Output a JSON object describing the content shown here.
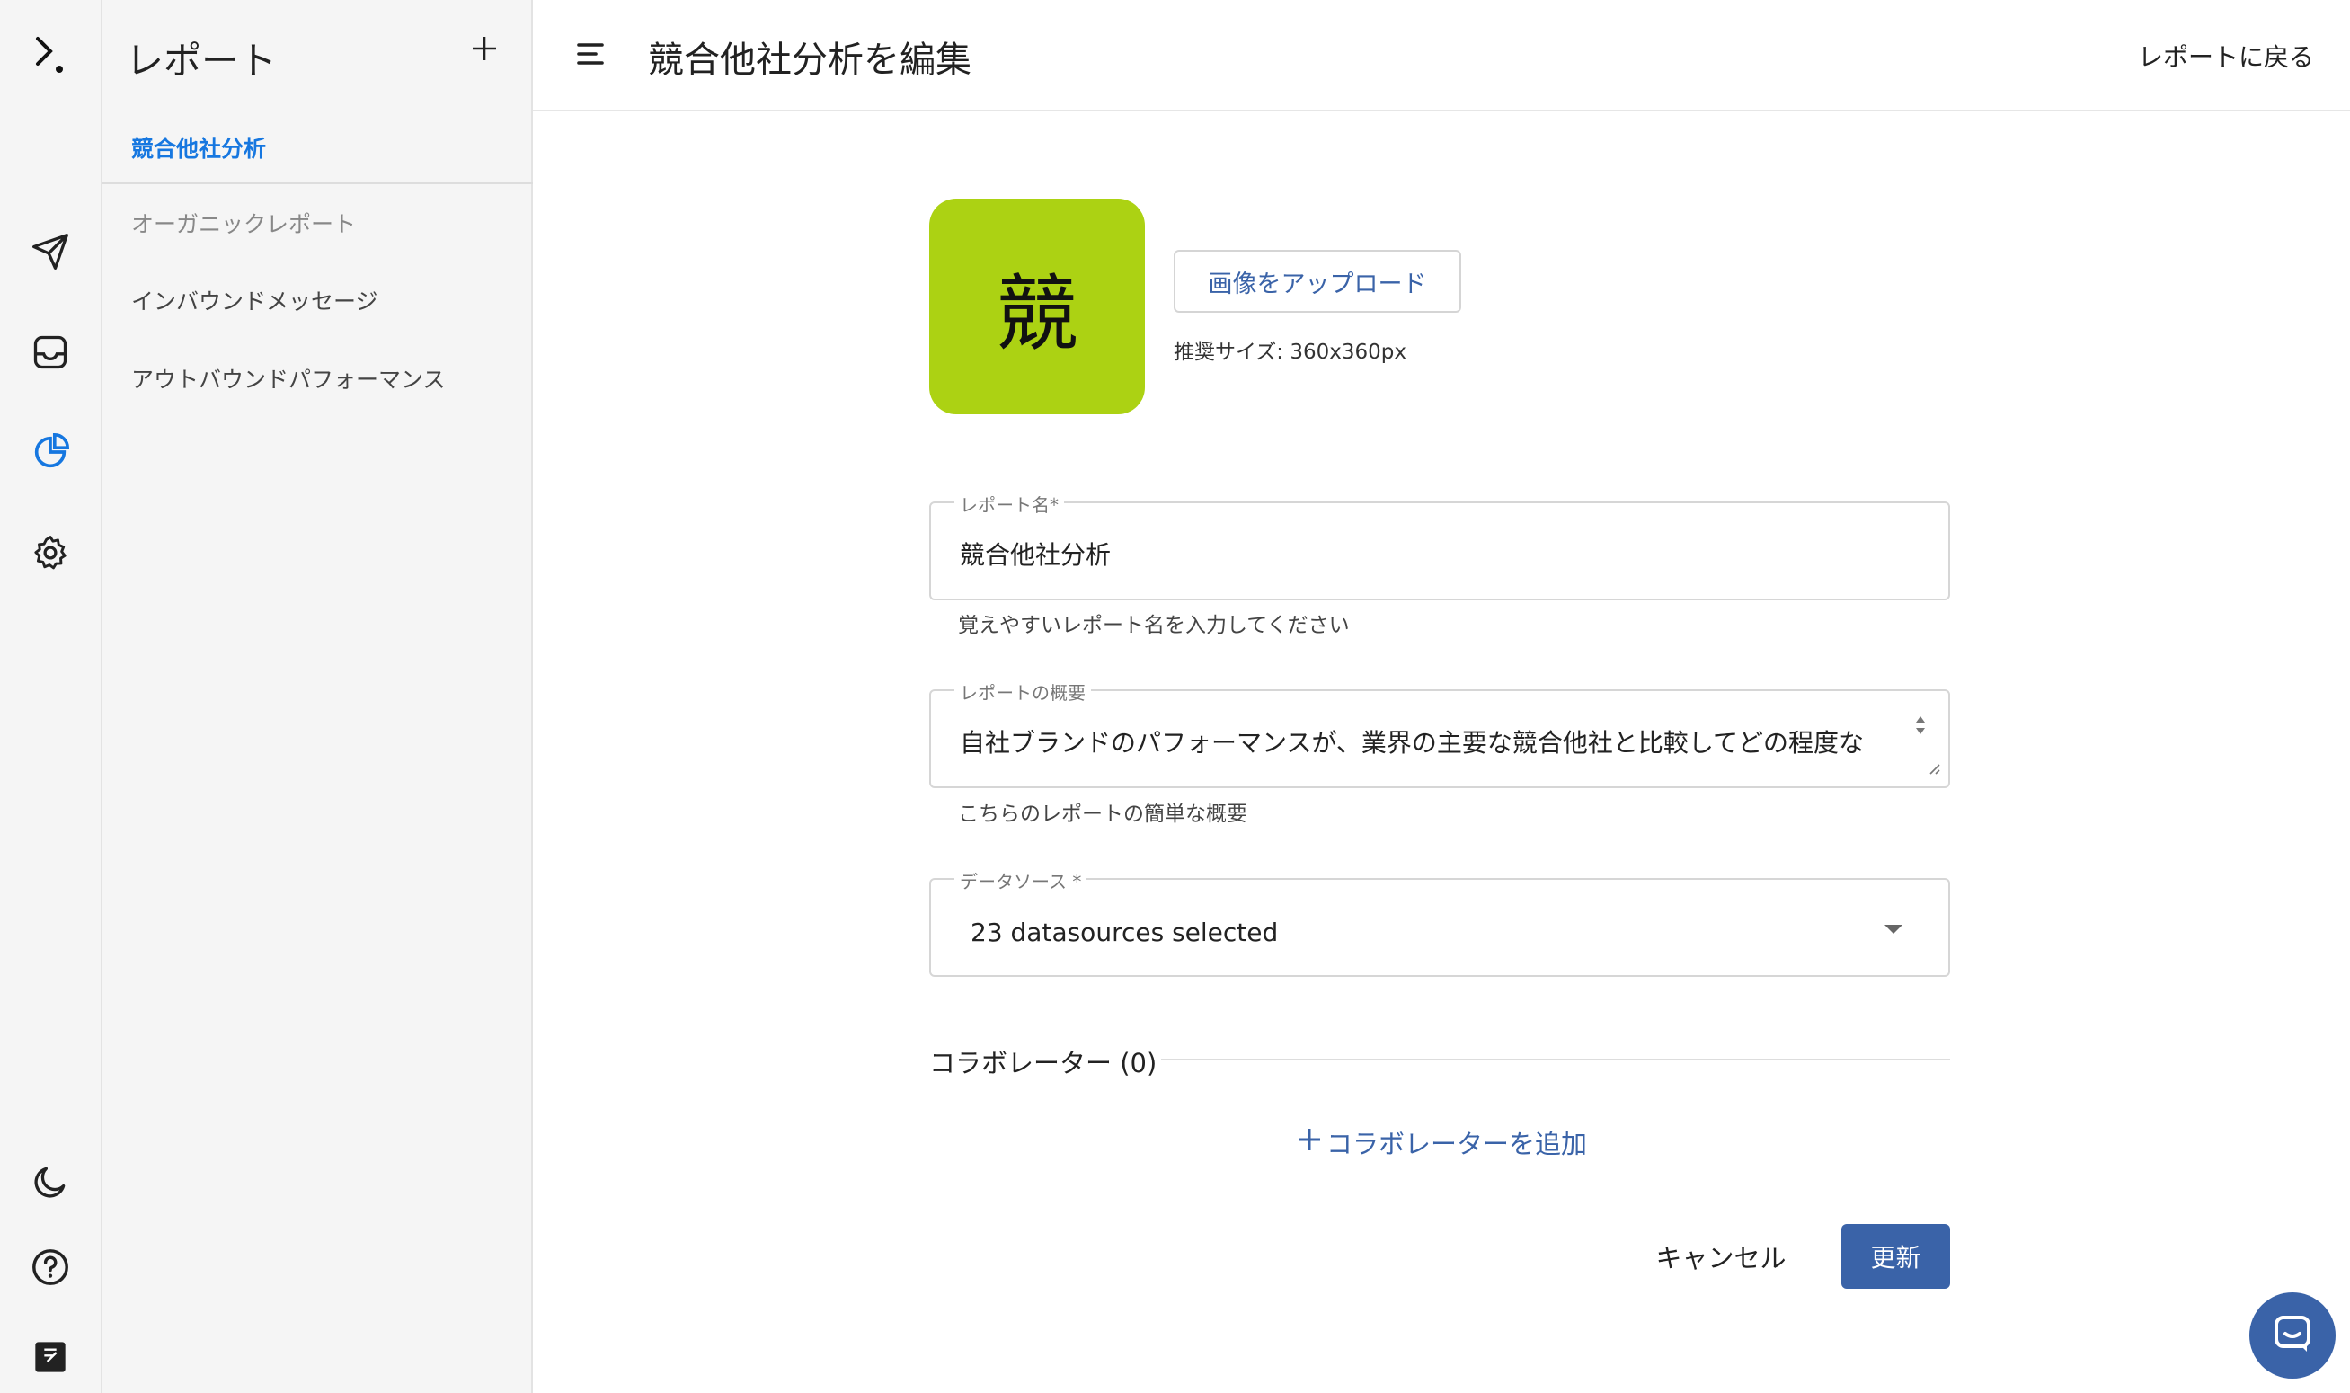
{
  "rail": {
    "icons": [
      "logo-icon",
      "send-icon",
      "inbox-icon",
      "pie-chart-icon",
      "gear-icon",
      "moon-icon",
      "help-icon",
      "notebook-icon"
    ]
  },
  "sidebar": {
    "title": "レポート",
    "items": [
      {
        "label": "競合他社分析",
        "state": "active"
      },
      {
        "label": "オーガニックレポート",
        "state": "dim"
      },
      {
        "label": "インバウンドメッセージ",
        "state": "normal"
      },
      {
        "label": "アウトバウンドパフォーマンス",
        "state": "normal"
      }
    ]
  },
  "header": {
    "title": "競合他社分析を編集",
    "back_link": "レポートに戻る"
  },
  "form": {
    "avatar_char": "競",
    "avatar_color": "#acd213",
    "upload_label": "画像をアップロード",
    "upload_hint": "推奨サイズ: 360x360px",
    "name_label": "レポート名*",
    "name_value": "競合他社分析",
    "name_helper": "覚えやすいレポート名を入力してください",
    "summary_label": "レポートの概要",
    "summary_value": "自社ブランドのパフォーマンスが、業界の主要な競合他社と比較してどの程度な",
    "summary_helper": "こちらのレポートの簡単な概要",
    "datasource_label": "データソース *",
    "datasource_value": "23 datasources selected",
    "collaborators_label": "コラボレーター (0)",
    "add_collaborator_label": "コラボレーターを追加",
    "cancel_label": "キャンセル",
    "update_label": "更新"
  },
  "colors": {
    "accent": "#3a63a8",
    "active_link": "#1677e0"
  }
}
